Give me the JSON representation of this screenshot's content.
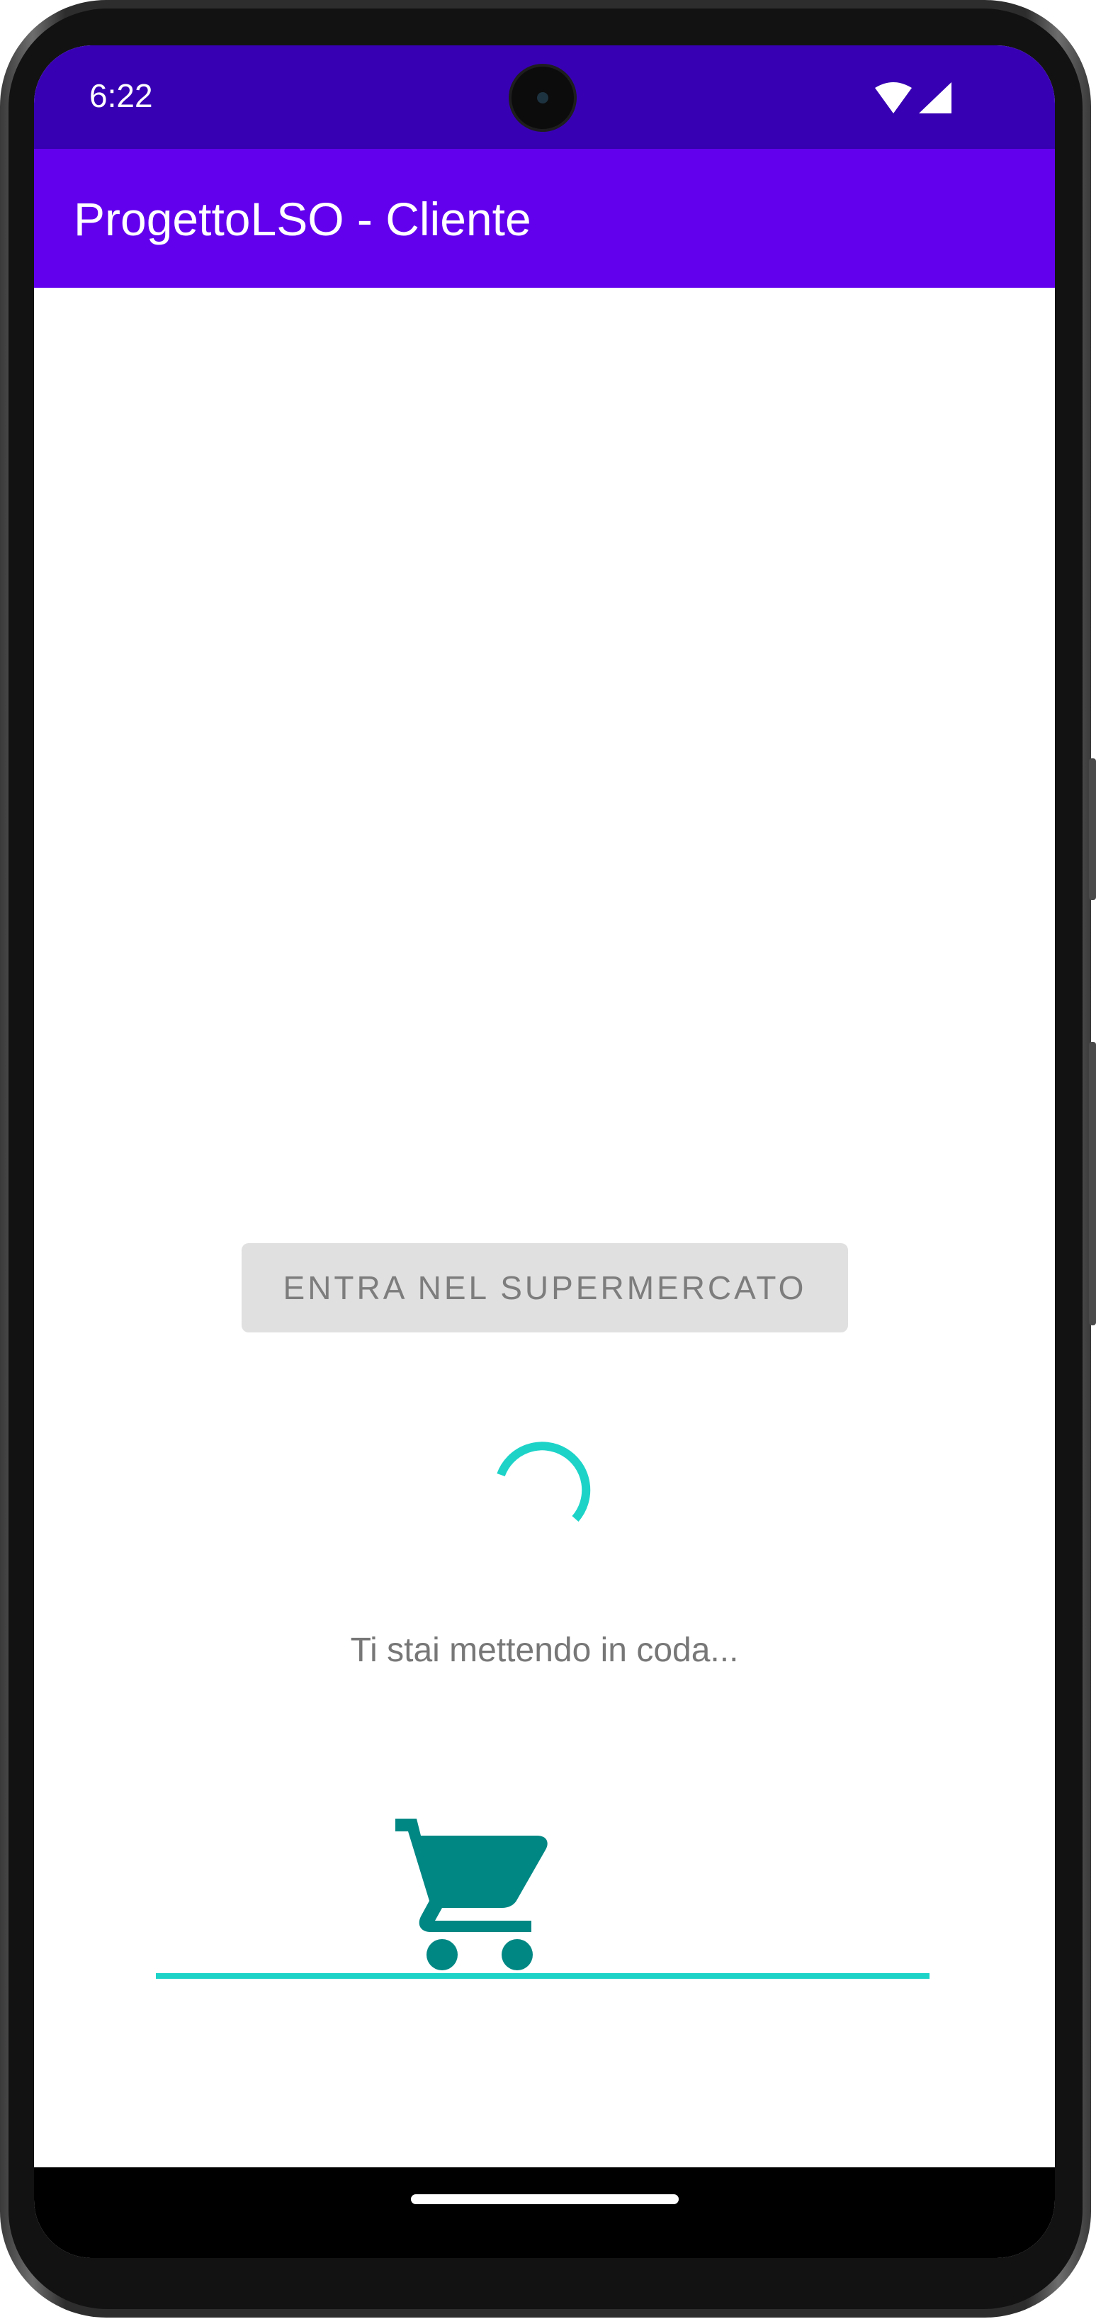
{
  "status_bar": {
    "time": "6:22",
    "icons": [
      "wifi-icon",
      "cellular-signal-icon",
      "camera-cutout"
    ]
  },
  "app_bar": {
    "title": "ProgettoLSO - Cliente"
  },
  "main": {
    "enter_button_label": "ENTRA NEL SUPERMERCATO",
    "enter_button_state": "disabled",
    "queue_status_text": "Ti stai mettendo in coda...",
    "cart_icon": "shopping-cart-icon",
    "progress": 1.0
  },
  "colors": {
    "status_bar": "#3700b3",
    "app_bar": "#6200ee",
    "spinner": "#1dd3c8",
    "cart": "#008784",
    "progress_line": "#1dd3c8",
    "button_background": "#e0e0e0",
    "button_text": "#7d7d7d",
    "secondary_text": "#777777"
  }
}
